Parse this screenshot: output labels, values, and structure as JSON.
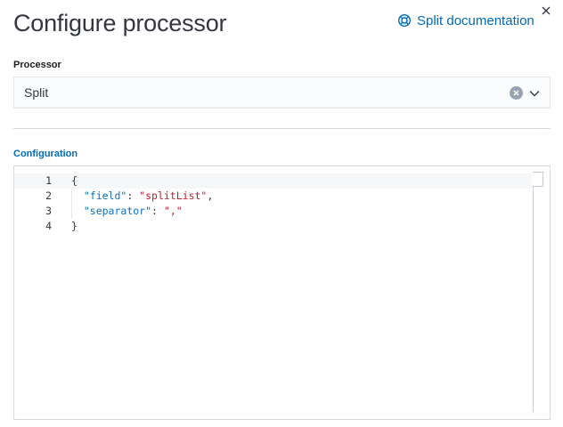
{
  "header": {
    "title": "Configure processor",
    "doc_link": "Split documentation",
    "doc_icon": "lifebuoy-icon",
    "close_icon": "close-icon"
  },
  "processor_field": {
    "label": "Processor",
    "value": "Split",
    "clear_icon": "clear-icon",
    "dropdown_icon": "chevron-down-icon"
  },
  "configuration": {
    "label": "Configuration",
    "line_numbers": [
      "1",
      "2",
      "3",
      "4"
    ],
    "lines": [
      [
        {
          "text": "{",
          "type": "punc"
        }
      ],
      [
        {
          "text": "  ",
          "type": "punc"
        },
        {
          "text": "\"field\"",
          "type": "key"
        },
        {
          "text": ": ",
          "type": "punc"
        },
        {
          "text": "\"splitList\"",
          "type": "str"
        },
        {
          "text": ",",
          "type": "punc"
        }
      ],
      [
        {
          "text": "  ",
          "type": "punc"
        },
        {
          "text": "\"separator\"",
          "type": "key"
        },
        {
          "text": ": ",
          "type": "punc"
        },
        {
          "text": "\",\"",
          "type": "str"
        }
      ],
      [
        {
          "text": "}",
          "type": "punc"
        }
      ]
    ]
  },
  "colors": {
    "accent": "#006bb8",
    "json_key": "#0b6fbf",
    "json_string": "#bf1e2d"
  }
}
